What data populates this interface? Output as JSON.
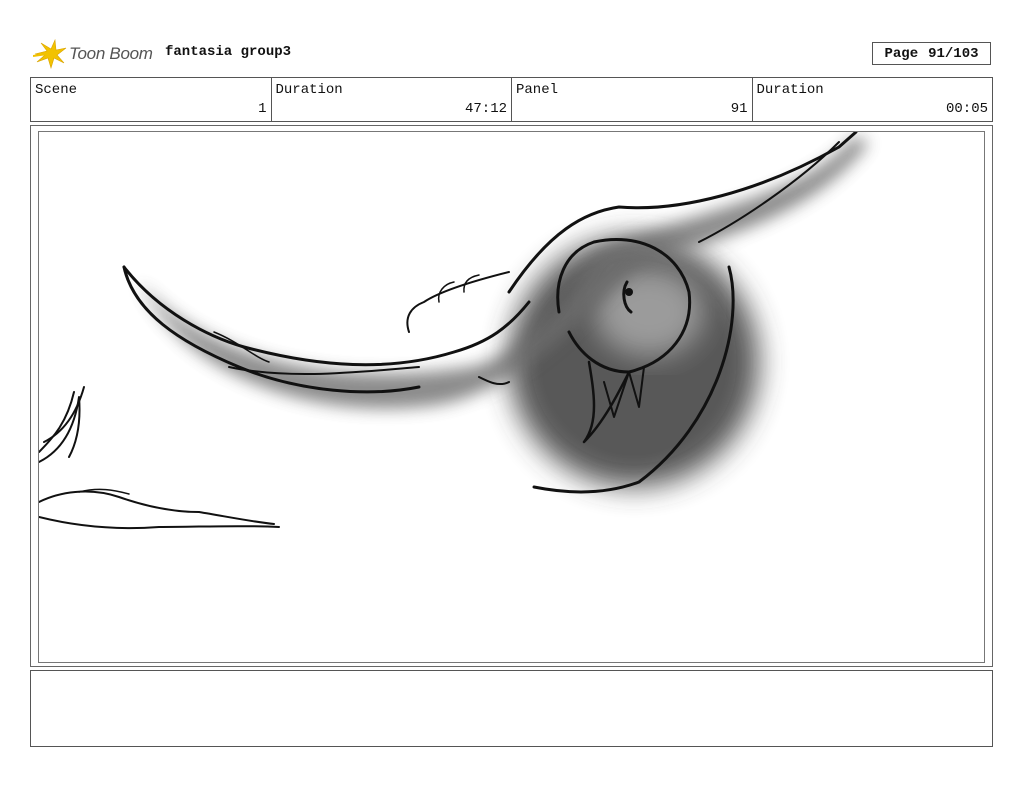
{
  "header": {
    "logo_text": "Toon Boom",
    "project_title": "fantasia group3",
    "page_label": "Page",
    "page_number": "91/103"
  },
  "info": {
    "scene_label": "Scene",
    "scene_value": "1",
    "duration_label": "Duration",
    "duration_value": "47:12",
    "panel_label": "Panel",
    "panel_value": "91",
    "panel_duration_label": "Duration",
    "panel_duration_value": "00:05"
  },
  "colors": {
    "logo_star": "#f2c200",
    "border": "#555555",
    "ink": "#111111"
  },
  "panel_drawing": {
    "description_icon": "bird-sketch",
    "notes": ""
  }
}
